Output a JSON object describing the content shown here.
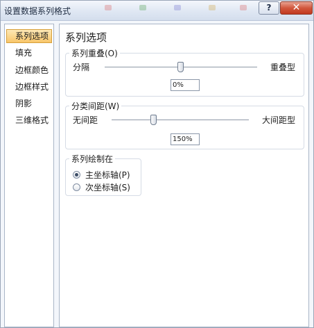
{
  "window": {
    "title": "设置数据系列格式",
    "help_label": "?",
    "close_label": "✕"
  },
  "nav": {
    "items": [
      {
        "label": "系列选项",
        "selected": true
      },
      {
        "label": "填充"
      },
      {
        "label": "边框颜色"
      },
      {
        "label": "边框样式"
      },
      {
        "label": "阴影"
      },
      {
        "label": "三维格式"
      }
    ]
  },
  "series_options": {
    "title": "系列选项",
    "overlap": {
      "label": "系列重叠(O)",
      "left_label": "分隔",
      "right_label": "重叠型",
      "value": "0%",
      "slider_fraction": 0.5
    },
    "gap_width": {
      "label": "分类间距(W)",
      "left_label": "无间距",
      "right_label": "大间距型",
      "value": "150%",
      "slider_fraction": 0.3
    },
    "plot_on": {
      "label": "系列绘制在",
      "options": [
        {
          "label": "主坐标轴(P)",
          "checked": true
        },
        {
          "label": "次坐标轴(S)",
          "checked": false
        }
      ]
    }
  }
}
